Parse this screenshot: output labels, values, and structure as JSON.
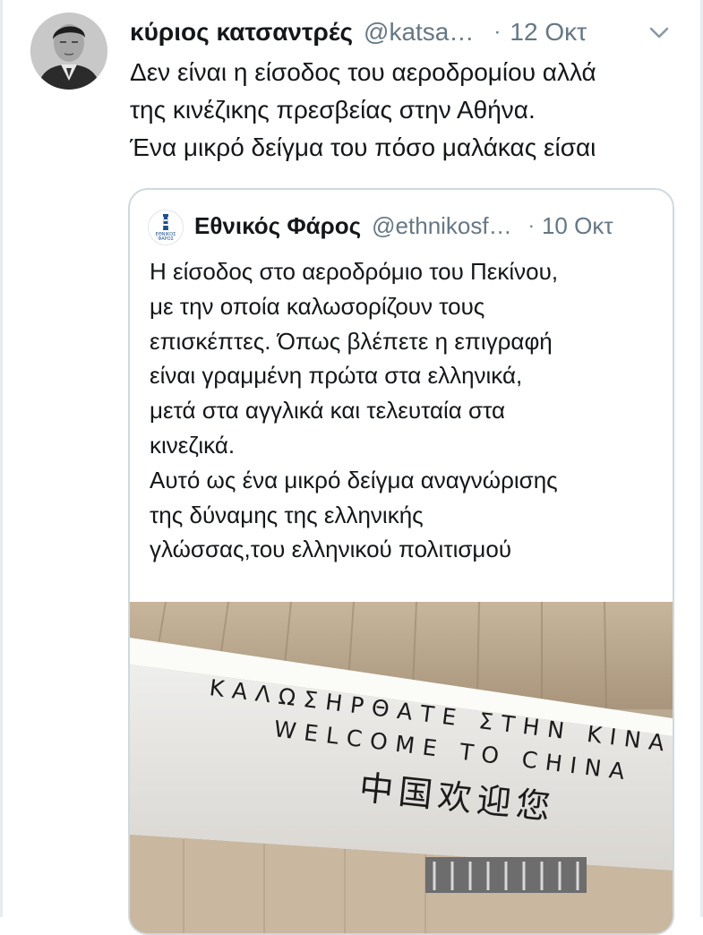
{
  "tweet": {
    "author_name": "κύριος κατσαντρές",
    "author_handle": "@katsa…",
    "separator": "·",
    "timestamp": "12 Οκτ",
    "text_lines": [
      "Δεν είναι η είσοδος του αεροδρομίου αλλά",
      "της κινέζικης πρεσβείας στην Αθήνα.",
      "Ένα μικρό δείγμα του πόσο μαλάκας είσαι"
    ],
    "menu_icon": "chevron-down-icon",
    "avatar_icon": "profile-photo"
  },
  "quoted_tweet": {
    "author_name": "Εθνικός Φάρος",
    "author_handle": "@ethnikosf…",
    "separator": "·",
    "timestamp": "10 Οκτ",
    "avatar_logo_text": "ΕΘΝΙΚΟΣ ΦΑΡΟΣ",
    "text_lines": [
      "Η είσοδος στο αεροδρόμιο του Πεκίνου,",
      "με την οποία καλωσορίζουν τους",
      "επισκέπτες. Όπως βλέπετε η επιγραφή",
      "είναι γραμμένη πρώτα στα ελληνικά,",
      "μετά στα αγγλικά και τελευταία στα",
      "κινεζικά.",
      "Αυτό ως ένα μικρό δείγμα αναγνώρισης",
      "της δύναμης της ελληνικής",
      "γλώσσας,του ελληνικού πολιτισμού"
    ],
    "photo": {
      "sign_greek": "ΚΑΛΩΣΗΡΘΑΤΕ ΣΤΗΝ ΚΙΝΑ",
      "sign_english": "WELCOME TO CHINA",
      "sign_chinese": "中国欢迎您"
    }
  },
  "colors": {
    "text": "#14171a",
    "secondary": "#657786",
    "border": "#cfd9de"
  }
}
